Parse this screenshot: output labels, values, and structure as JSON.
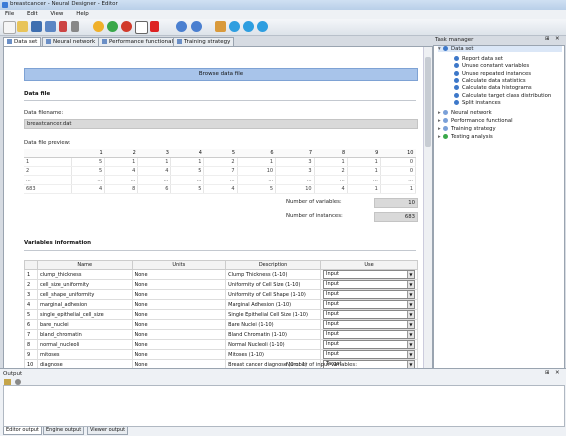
{
  "window": {
    "title": "breastcancer - Neural Designer - Editor"
  },
  "menu": [
    "File",
    "Edit",
    "View",
    "Help"
  ],
  "toolbar": {
    "icons": [
      "new-file-icon",
      "open-folder-icon",
      "save-icon",
      "save-as-icon",
      "cut-icon",
      "properties-icon",
      "add-icon",
      "refresh-icon",
      "stop-icon",
      "crop-icon",
      "delete-icon",
      "back-icon",
      "forward-icon",
      "home-icon",
      "next-icon",
      "zoom-in-icon",
      "zoom-out-icon"
    ]
  },
  "tabs": [
    "Data set",
    "Neural network",
    "Performance functional",
    "Training strategy"
  ],
  "editor": {
    "browse_label": "Browse data file",
    "data_file_heading": "Data file",
    "filename_label": "Data filename:",
    "filename_value": "breastcancer.dat",
    "preview_label": "Data file preview:",
    "preview_headers": [
      "1",
      "2",
      "3",
      "4",
      "5",
      "6",
      "7",
      "8",
      "9",
      "10"
    ],
    "preview_rows": [
      {
        "idx": "1",
        "cells": [
          "5",
          "1",
          "1",
          "1",
          "2",
          "1",
          "3",
          "1",
          "1",
          "0"
        ]
      },
      {
        "idx": "2",
        "cells": [
          "5",
          "4",
          "4",
          "5",
          "7",
          "10",
          "3",
          "2",
          "1",
          "0"
        ]
      },
      {
        "idx": "...",
        "cells": [
          "...",
          "...",
          "...",
          "...",
          "...",
          "...",
          "...",
          "...",
          "...",
          "..."
        ]
      },
      {
        "idx": "683",
        "cells": [
          "4",
          "8",
          "6",
          "5",
          "4",
          "5",
          "10",
          "4",
          "1",
          "1"
        ]
      }
    ],
    "num_variables_label": "Number of variables:",
    "num_variables_value": "10",
    "num_instances_label": "Number of instances:",
    "num_instances_value": "683",
    "variables_heading": "Variables information",
    "var_headers": [
      "",
      "Name",
      "Units",
      "Description",
      "Use"
    ],
    "variables": [
      {
        "idx": "1",
        "name": "clump_thickness",
        "units": "None",
        "desc": "Clump Thickness (1-10)",
        "use": "Input"
      },
      {
        "idx": "2",
        "name": "cell_size_uniformity",
        "units": "None",
        "desc": "Uniformity of Cell Size (1-10)",
        "use": "Input"
      },
      {
        "idx": "3",
        "name": "cell_shape_uniformity",
        "units": "None",
        "desc": "Uniformity of Cell Shape (1-10)",
        "use": "Input"
      },
      {
        "idx": "4",
        "name": "marginal_adhesion",
        "units": "None",
        "desc": "Marginal Adhesion (1-10)",
        "use": "Input"
      },
      {
        "idx": "5",
        "name": "single_epithelial_cell_size",
        "units": "None",
        "desc": "Single Epithelial Cell Size (1-10)",
        "use": "Input"
      },
      {
        "idx": "6",
        "name": "bare_nuclei",
        "units": "None",
        "desc": "Bare Nuclei (1-10)",
        "use": "Input"
      },
      {
        "idx": "7",
        "name": "bland_chromatin",
        "units": "None",
        "desc": "Bland Chromatin (1-10)",
        "use": "Input"
      },
      {
        "idx": "8",
        "name": "normal_nucleoli",
        "units": "None",
        "desc": "Normal Nucleoli (1-10)",
        "use": "Input"
      },
      {
        "idx": "9",
        "name": "mitoses",
        "units": "None",
        "desc": "Mitoses (1-10)",
        "use": "Input"
      },
      {
        "idx": "10",
        "name": "diagnose",
        "units": "None",
        "desc": "Breast cancer diagnose (0 or 1)",
        "use": "Target"
      }
    ],
    "input_vars_label": "Number of input variables:"
  },
  "task_manager": {
    "title": "Task manager",
    "root": "Data set",
    "tasks": [
      "Report data set",
      "Unuse constant variables",
      "Unuse repeated instances",
      "Calculate data statistics",
      "Calculate data histograms",
      "Calculate target class distribution",
      "Split instances"
    ],
    "nodes": [
      "Neural network",
      "Performance functional",
      "Training strategy",
      "Testing analysis"
    ]
  },
  "output": {
    "title": "Output",
    "tabs": [
      "Editor output",
      "Engine output",
      "Viewer output"
    ]
  },
  "colors": {
    "accent": "#a8c4ea",
    "chrome": "#d6dbe2"
  }
}
